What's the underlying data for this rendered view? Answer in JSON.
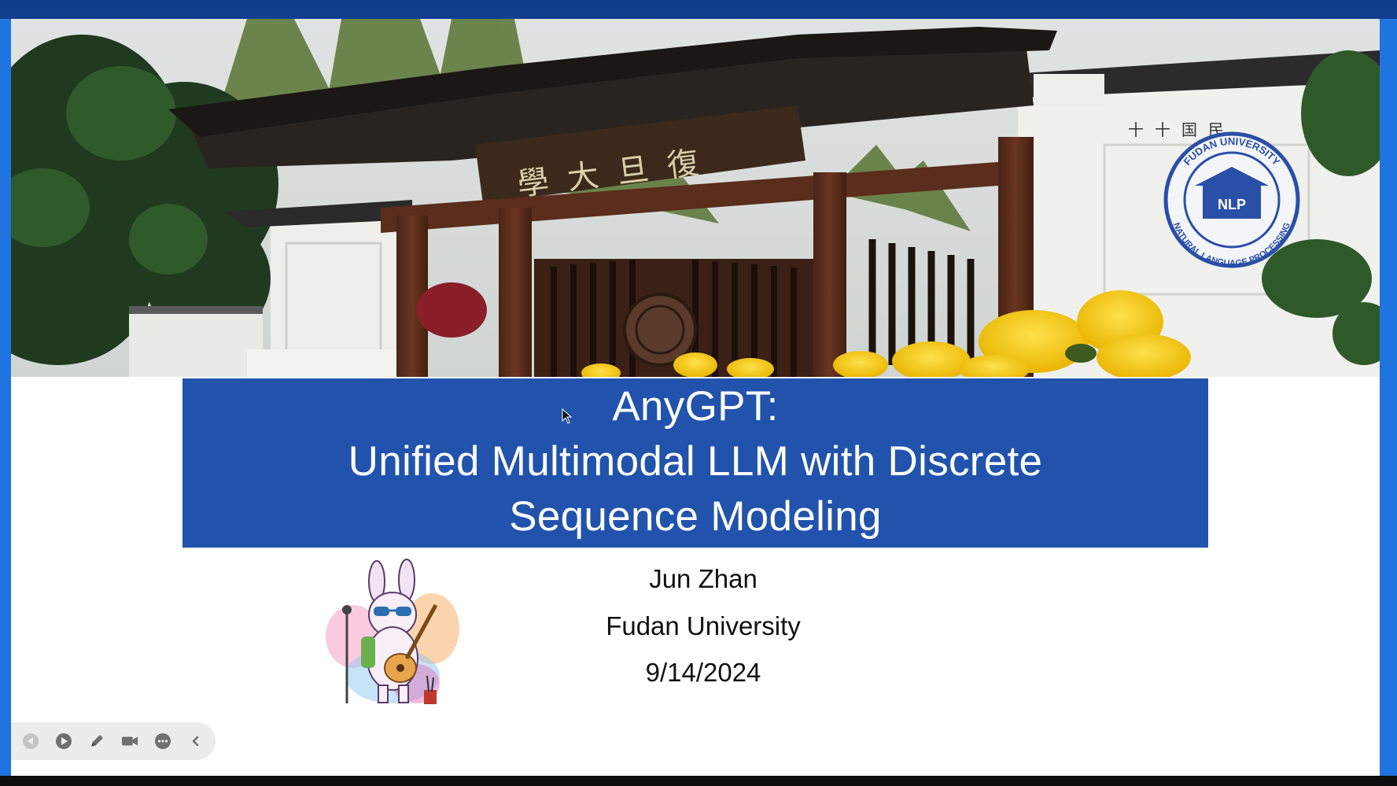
{
  "slide": {
    "title": "AnyGPT:",
    "subtitle_line1": "Unified Multimodal LLM with Discrete",
    "subtitle_line2": "Sequence Modeling",
    "author": "Jun Zhan",
    "affiliation": "Fudan University",
    "date": "9/14/2024"
  },
  "banner": {
    "gate_plaque": "復旦大學",
    "wall_inscription": "民国十十",
    "logo": {
      "top_text": "FUDAN UNIVERSITY",
      "bottom_text": "NATURAL LANGUAGE PROCESSING",
      "center_text": "NLP"
    }
  },
  "toolbar": {
    "buttons": [
      {
        "name": "previous-slide",
        "icon": "back-arrow-icon"
      },
      {
        "name": "next-slide",
        "icon": "play-icon"
      },
      {
        "name": "pen",
        "icon": "pen-icon"
      },
      {
        "name": "camera",
        "icon": "video-camera-icon"
      },
      {
        "name": "more",
        "icon": "more-icon"
      },
      {
        "name": "collapse",
        "icon": "chevron-left-icon"
      }
    ]
  },
  "colors": {
    "frame_blue": "#1f74e0",
    "title_box_blue": "#2153ad",
    "logo_blue": "#2a4fa8",
    "flower_yellow": "#f5c400"
  }
}
